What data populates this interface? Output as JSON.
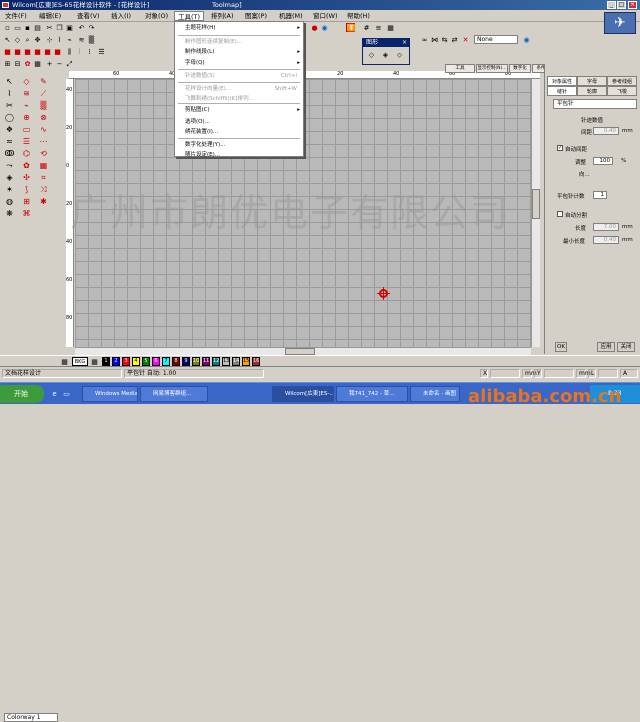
{
  "titlebar": {
    "title": "Wilcom[広東]ES-65花样设计软件 - [花样设计]",
    "subtitle": "Toolmap]"
  },
  "menubar": {
    "items": [
      "文件(F)",
      "编辑(E)",
      "查看(V)",
      "插入(I)",
      "对象(O)",
      "工具(T)",
      "排列(A)",
      "图案(P)",
      "机器(M)",
      "窗口(W)",
      "帮助(H)"
    ]
  },
  "dropmenu": {
    "items": [
      {
        "label": "主题花样(H)",
        "shortcut": "",
        "arrow": "▸",
        "disabled": false
      },
      {
        "label": "制作图形连续复制(E)...",
        "shortcut": "",
        "arrow": "",
        "disabled": true
      },
      {
        "label": "制作线段(L)",
        "shortcut": "",
        "arrow": "▸",
        "disabled": false
      },
      {
        "label": "字母(Q)",
        "shortcut": "",
        "arrow": "▸",
        "disabled": false
      },
      {
        "label": "针迹数值(S)",
        "shortcut": "Ctrl+I",
        "arrow": "",
        "disabled": true
      },
      {
        "label": "花样设计向量(E)...",
        "shortcut": "Shift+W",
        "arrow": "",
        "disabled": true
      },
      {
        "label": "飞舞刺绣(Schiffli)(K)排列...",
        "shortcut": "",
        "arrow": "",
        "disabled": true
      },
      {
        "label": "剪贴图(C)",
        "shortcut": "",
        "arrow": "▸",
        "disabled": false
      },
      {
        "label": "选项(O)...",
        "shortcut": "",
        "arrow": "",
        "disabled": false
      },
      {
        "label": "绣花装置(I)...",
        "shortcut": "",
        "arrow": "",
        "disabled": false
      },
      {
        "label": "数字化处理(Y)...",
        "shortcut": "",
        "arrow": "",
        "disabled": false
      },
      {
        "label": "随片设定(E)...",
        "shortcut": "",
        "arrow": "",
        "disabled": false
      }
    ]
  },
  "floatbox": {
    "title": "图形",
    "close": "×"
  },
  "toolbar": {
    "none_label": "None"
  },
  "ruler": {
    "h_ticks": [
      "60",
      "40",
      "20",
      "0",
      "20",
      "40",
      "60",
      "80"
    ],
    "v_ticks": [
      "40",
      "20",
      "0",
      "20",
      "40",
      "60",
      "80"
    ]
  },
  "tabs_top": [
    "工具(Chen...)",
    "显示控制(N)...",
    "数字化",
    "条件",
    "结构式",
    "文字",
    "刺绣软件(Sch..)"
  ],
  "panel": {
    "tabs_row1": [
      "对象属性",
      "字母",
      "参考线组"
    ],
    "tabs_row2": [
      "缝针",
      "轮廓",
      "飞梭"
    ],
    "stitch_type": "平包针",
    "section1": "针迹数值",
    "spacing_label": "间距",
    "spacing_value": "0.40",
    "unit_mm": "mm",
    "auto_spacing_label": "自动间距",
    "auto_spacing_checked": "✓",
    "adjust_label": "调整",
    "adjust_value": "100",
    "unit_pct": "%",
    "moves_label": "向...",
    "stitch_count_label": "平包针计数",
    "stitch_count_value": "1",
    "auto_split_label": "自动分割",
    "length_label": "长度",
    "length_value": "7.00",
    "min_length_label": "最小长度",
    "min_length_value": "0.40",
    "btn_ok": "OK",
    "btn_apply": "应用",
    "btn_close": "关闭"
  },
  "left_combo": "Colorway 1",
  "colorbar": {
    "label": "BKG",
    "swatches": [
      "#000000",
      "#0000ff",
      "#ff0000",
      "#ffff00",
      "#008000",
      "#ff00ff",
      "#00ffff",
      "#800000",
      "#000080",
      "#808000",
      "#800080",
      "#008080",
      "#c0c0c0",
      "#808080",
      "#ffa500",
      "#a52a2a"
    ],
    "numbers": [
      "1",
      "2",
      "3",
      "4",
      "5",
      "6",
      "7",
      "8",
      "9",
      "10",
      "11",
      "12",
      "13",
      "14",
      "15",
      "16"
    ]
  },
  "statusbar": {
    "left": "文档花样设计",
    "center": "平包针 自动: 1.00",
    "x_label": "X",
    "y_label": "Y",
    "l_label": "L",
    "a_label": "A",
    "unit": "mm",
    "deg": "°"
  },
  "taskbar": {
    "start": "开始",
    "tasks": [
      "Windows Media ...",
      "网易博客群组...",
      "Wilcom[広東]ES-...",
      "我741_742 - 草...",
      "未命名 - 画图"
    ],
    "clock": "8:33"
  },
  "watermark": "广州市朗优电子有限公司",
  "site_watermark": "alibaba.com.cn"
}
